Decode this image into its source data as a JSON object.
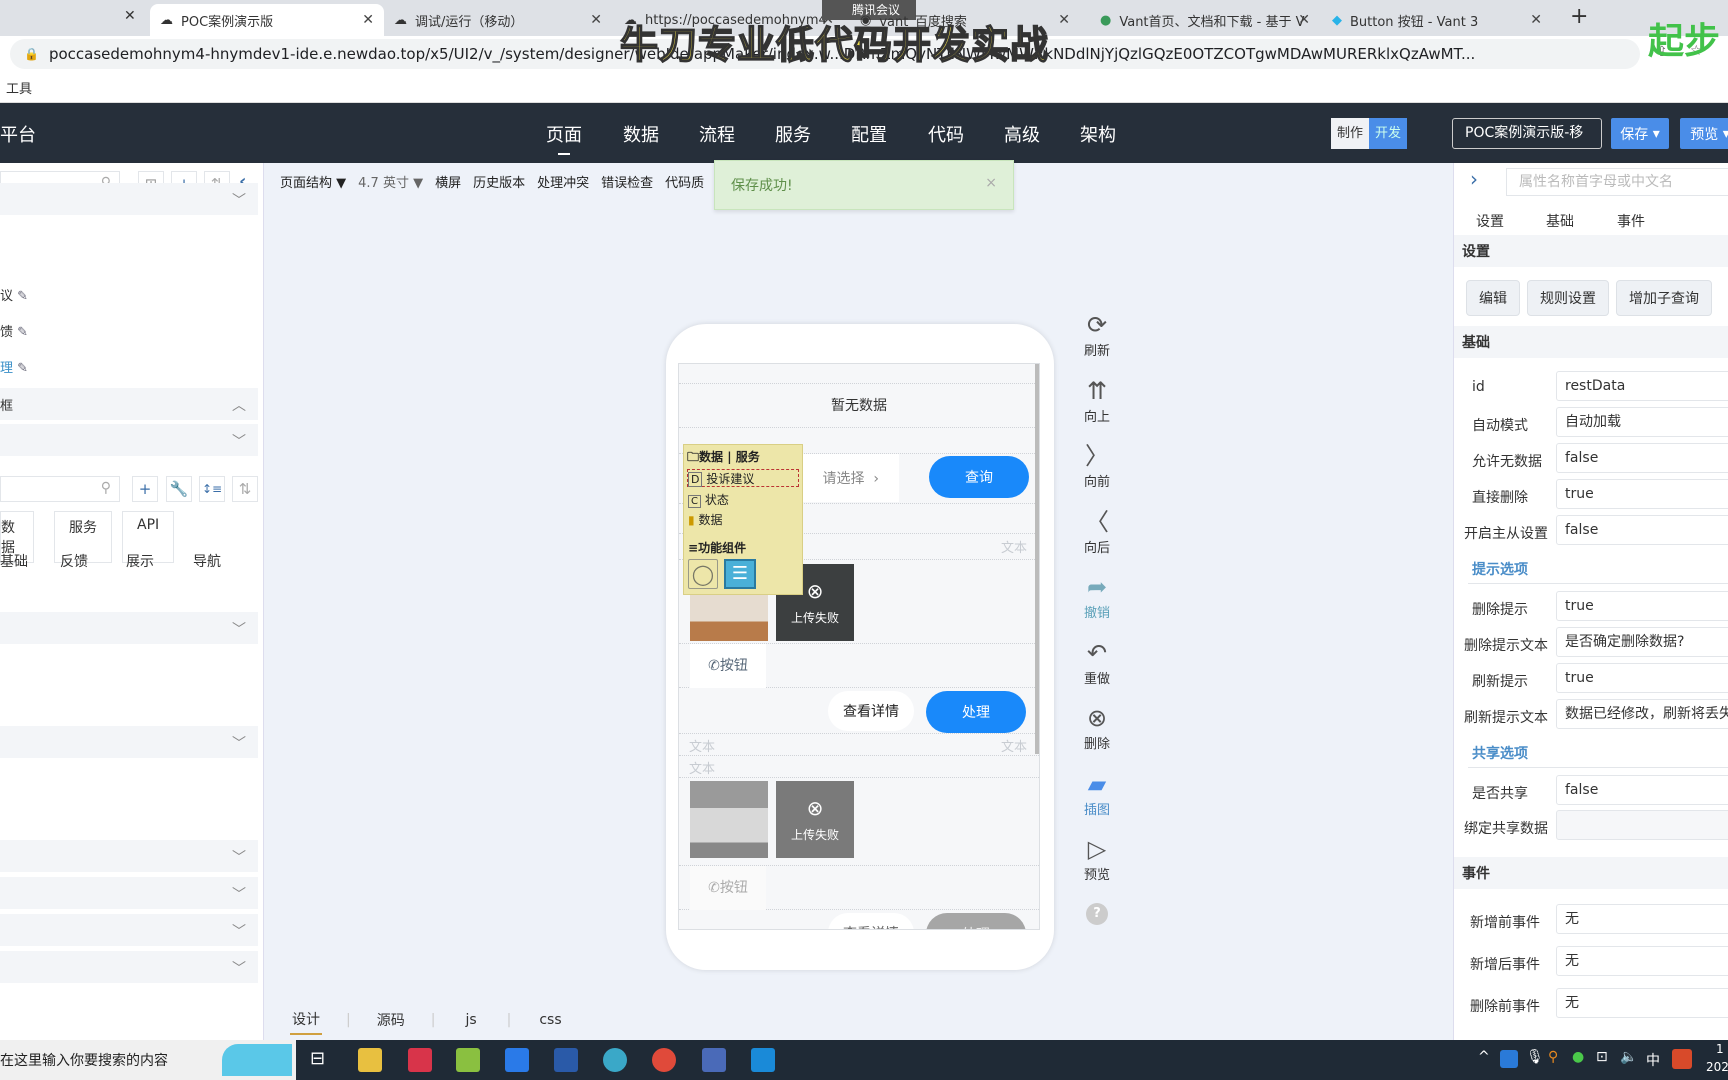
{
  "browser": {
    "tabs": [
      {
        "label": "POC案例演示版",
        "active": true
      },
      {
        "label": "调试/运行（移动）"
      },
      {
        "label": "https://poccasedemohnym4"
      },
      {
        "label": "vant_百度搜索"
      },
      {
        "label": "Vant首页、文档和下载 - 基于 V"
      },
      {
        "label": "Button 按钮 - Vant 3"
      }
    ],
    "new_tab": "+",
    "meeting_badge": "腾讯会议",
    "url": "poccasedemohnym4-hnymdev1-ide.e.newdao.top/x5/UI2/v_/system/designer/webIde/appMaker/index.w...DRmZmQyNTIlNWMwMWRkNDdlNjYjQzlGQzE0OTZCOTgwMDAwMURERklxQzAwMT...",
    "bookmark": "工具"
  },
  "overlay": {
    "title": "牛刀专业低代码开发实战",
    "corner": "起步"
  },
  "header": {
    "brand": "平台",
    "nav": [
      {
        "label": "页面",
        "active": true
      },
      {
        "label": "数据"
      },
      {
        "label": "流程"
      },
      {
        "label": "服务"
      },
      {
        "label": "配置"
      },
      {
        "label": "代码"
      },
      {
        "label": "高级"
      },
      {
        "label": "架构"
      }
    ],
    "mode": {
      "make": "制作",
      "dev": "开发",
      "active": "开发"
    },
    "project": "POC案例演示版-移",
    "save": "保存",
    "preview": "预览"
  },
  "left": {
    "tree_items": [
      {
        "label": "议"
      },
      {
        "label": "馈"
      },
      {
        "label": "理",
        "active": true
      }
    ],
    "section_frame": "框",
    "tabs": [
      "数据",
      "服务",
      "API"
    ],
    "categories": [
      "基础",
      "反馈",
      "展示",
      "导航"
    ]
  },
  "toolbar": {
    "items": [
      "页面结构 ▼",
      "4.7 英寸 ▼",
      "横屏",
      "历史版本",
      "处理冲突",
      "错误检查",
      "代码质"
    ]
  },
  "toast": {
    "message": "保存成功!",
    "close": "×"
  },
  "phone": {
    "empty": "暂无数据",
    "select_placeholder": "请选择",
    "query": "查询",
    "text": "文本",
    "upload_failed": "上传失败",
    "button": "按钮",
    "details": "查看详情",
    "handle": "处理"
  },
  "popup": {
    "title": "数据 | 服务",
    "items": [
      {
        "badge": "D",
        "label": "投诉建议",
        "selected": true
      },
      {
        "badge": "C",
        "label": "状态"
      },
      {
        "badge": "",
        "label": "数据"
      }
    ],
    "components": "功能组件"
  },
  "tools": [
    {
      "icon": "refresh",
      "label": "刷新"
    },
    {
      "icon": "up",
      "label": "向上"
    },
    {
      "icon": "forward",
      "label": "向前"
    },
    {
      "icon": "back",
      "label": "向后"
    },
    {
      "icon": "undo",
      "label": "撤销",
      "active": true
    },
    {
      "icon": "redo",
      "label": "重做"
    },
    {
      "icon": "delete",
      "label": "删除"
    },
    {
      "icon": "image",
      "label": "插图",
      "active": true
    },
    {
      "icon": "preview",
      "label": "预览"
    },
    {
      "icon": "help",
      "label": "?"
    }
  ],
  "bottom_tabs": [
    {
      "label": "设计",
      "active": true
    },
    {
      "label": "源码"
    },
    {
      "label": "js"
    },
    {
      "label": "css"
    }
  ],
  "right": {
    "search_placeholder": "属性名称首字母或中文名",
    "tabs": [
      "设置",
      "基础",
      "事件"
    ],
    "settings_header": "设置",
    "buttons": [
      "编辑",
      "规则设置",
      "增加子查询"
    ],
    "basic_header": "基础",
    "basic": [
      {
        "label": "id",
        "value": "restData"
      },
      {
        "label": "自动模式",
        "value": "自动加载"
      },
      {
        "label": "允许无数据",
        "value": "false"
      },
      {
        "label": "直接删除",
        "value": "true"
      },
      {
        "label": "开启主从设置",
        "value": "false"
      }
    ],
    "hint_header": "提示选项",
    "hints": [
      {
        "label": "删除提示",
        "value": "true"
      },
      {
        "label": "删除提示文本",
        "value": "是否确定删除数据?"
      },
      {
        "label": "刷新提示",
        "value": "true"
      },
      {
        "label": "刷新提示文本",
        "value": "数据已经修改，刷新将丢失"
      }
    ],
    "share_header": "共享选项",
    "share": [
      {
        "label": "是否共享",
        "value": "false"
      },
      {
        "label": "绑定共享数据",
        "value": ""
      }
    ],
    "events_header": "事件",
    "events": [
      {
        "label": "新增前事件",
        "value": "无"
      },
      {
        "label": "新增后事件",
        "value": "无"
      },
      {
        "label": "删除前事件",
        "value": "无"
      }
    ]
  },
  "taskbar": {
    "search": "在这里输入你要搜索的内容",
    "ime": "中",
    "clock": "1",
    "date": "202"
  },
  "colors": {
    "accent": "#1989fa",
    "header": "#262f3a",
    "save_blue": "#4a8de8",
    "toast_bg": "#dff0d8",
    "popup_bg": "#ede6a9"
  }
}
